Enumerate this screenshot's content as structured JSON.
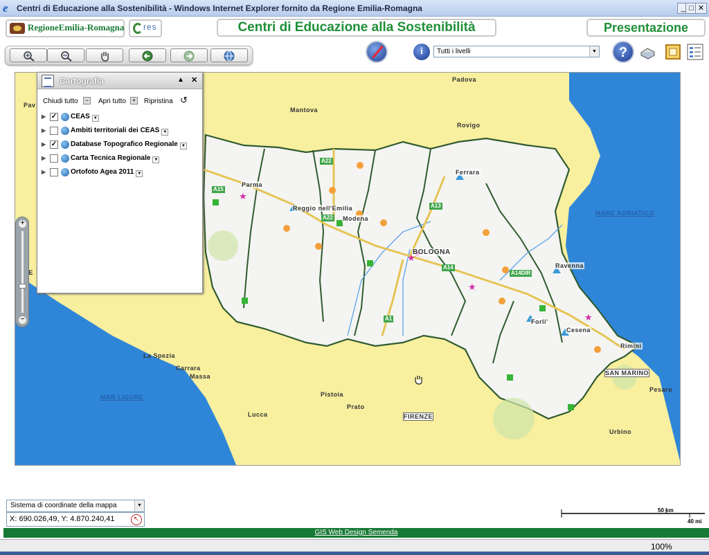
{
  "window": {
    "title": "Centri di Educazione alla Sostenibilità - Windows Internet Explorer fornito da Regione Emilia-Romagna"
  },
  "header": {
    "logo_text": "RegioneEmilia-Romagna",
    "res_logo_text": "res",
    "title": "Centri di Educazione alla Sostenibilità",
    "presentation_label": "Presentazione"
  },
  "toolbar": {
    "levels_value": "Tutti i livelli",
    "info_label": "i",
    "help_label": "?"
  },
  "panel": {
    "title": "Cartografia",
    "close_all": "Chiudi tutto",
    "open_all": "Apri tutto",
    "reset": "Ripristina",
    "layers": [
      {
        "name": "CEAS",
        "checked": true
      },
      {
        "name": "Ambiti territoriali dei CEAS",
        "checked": false
      },
      {
        "name": "Database Topografico Regionale",
        "checked": true
      },
      {
        "name": "Carta Tecnica Regionale",
        "checked": false
      },
      {
        "name": "Ortofoto Agea 2011",
        "checked": false
      }
    ]
  },
  "map": {
    "places": [
      "Padova",
      "Mantova",
      "Rovigo",
      "Pav",
      "Ferrara",
      "Parma",
      "Reggio nell'Emilia",
      "Modena",
      "BOLOGNA",
      "Ravenna",
      "Forli'",
      "Cesena",
      "Rimini",
      "SAN MARINO",
      "Pesaro",
      "Urbino",
      "La Spezia",
      "Carrara",
      "Massa",
      "Lucca",
      "Pistoia",
      "Prato",
      "FIRENZE",
      "GE"
    ],
    "seas": [
      "MARE ADRIATICO",
      "MAR LIGURE"
    ],
    "roads": [
      "A22",
      "A15",
      "A22",
      "A13",
      "A14",
      "A14DIR",
      "A1"
    ]
  },
  "bottom": {
    "coord_system": "Sistema di coordinate della mappa",
    "coords": "X: 690.026,49, Y: 4.870.240,41",
    "scale_km": "50 km",
    "scale_mi": "40 mi",
    "footer_link": "GIS Web Design Semenda",
    "zoom_level": "100%"
  },
  "colors": {
    "brand_green": "#1f8f38",
    "sea": "#2f86d8",
    "land_outside": "#f8ef9f",
    "region_fill": "#f4f4f2",
    "boundary": "#2f5b2f"
  }
}
